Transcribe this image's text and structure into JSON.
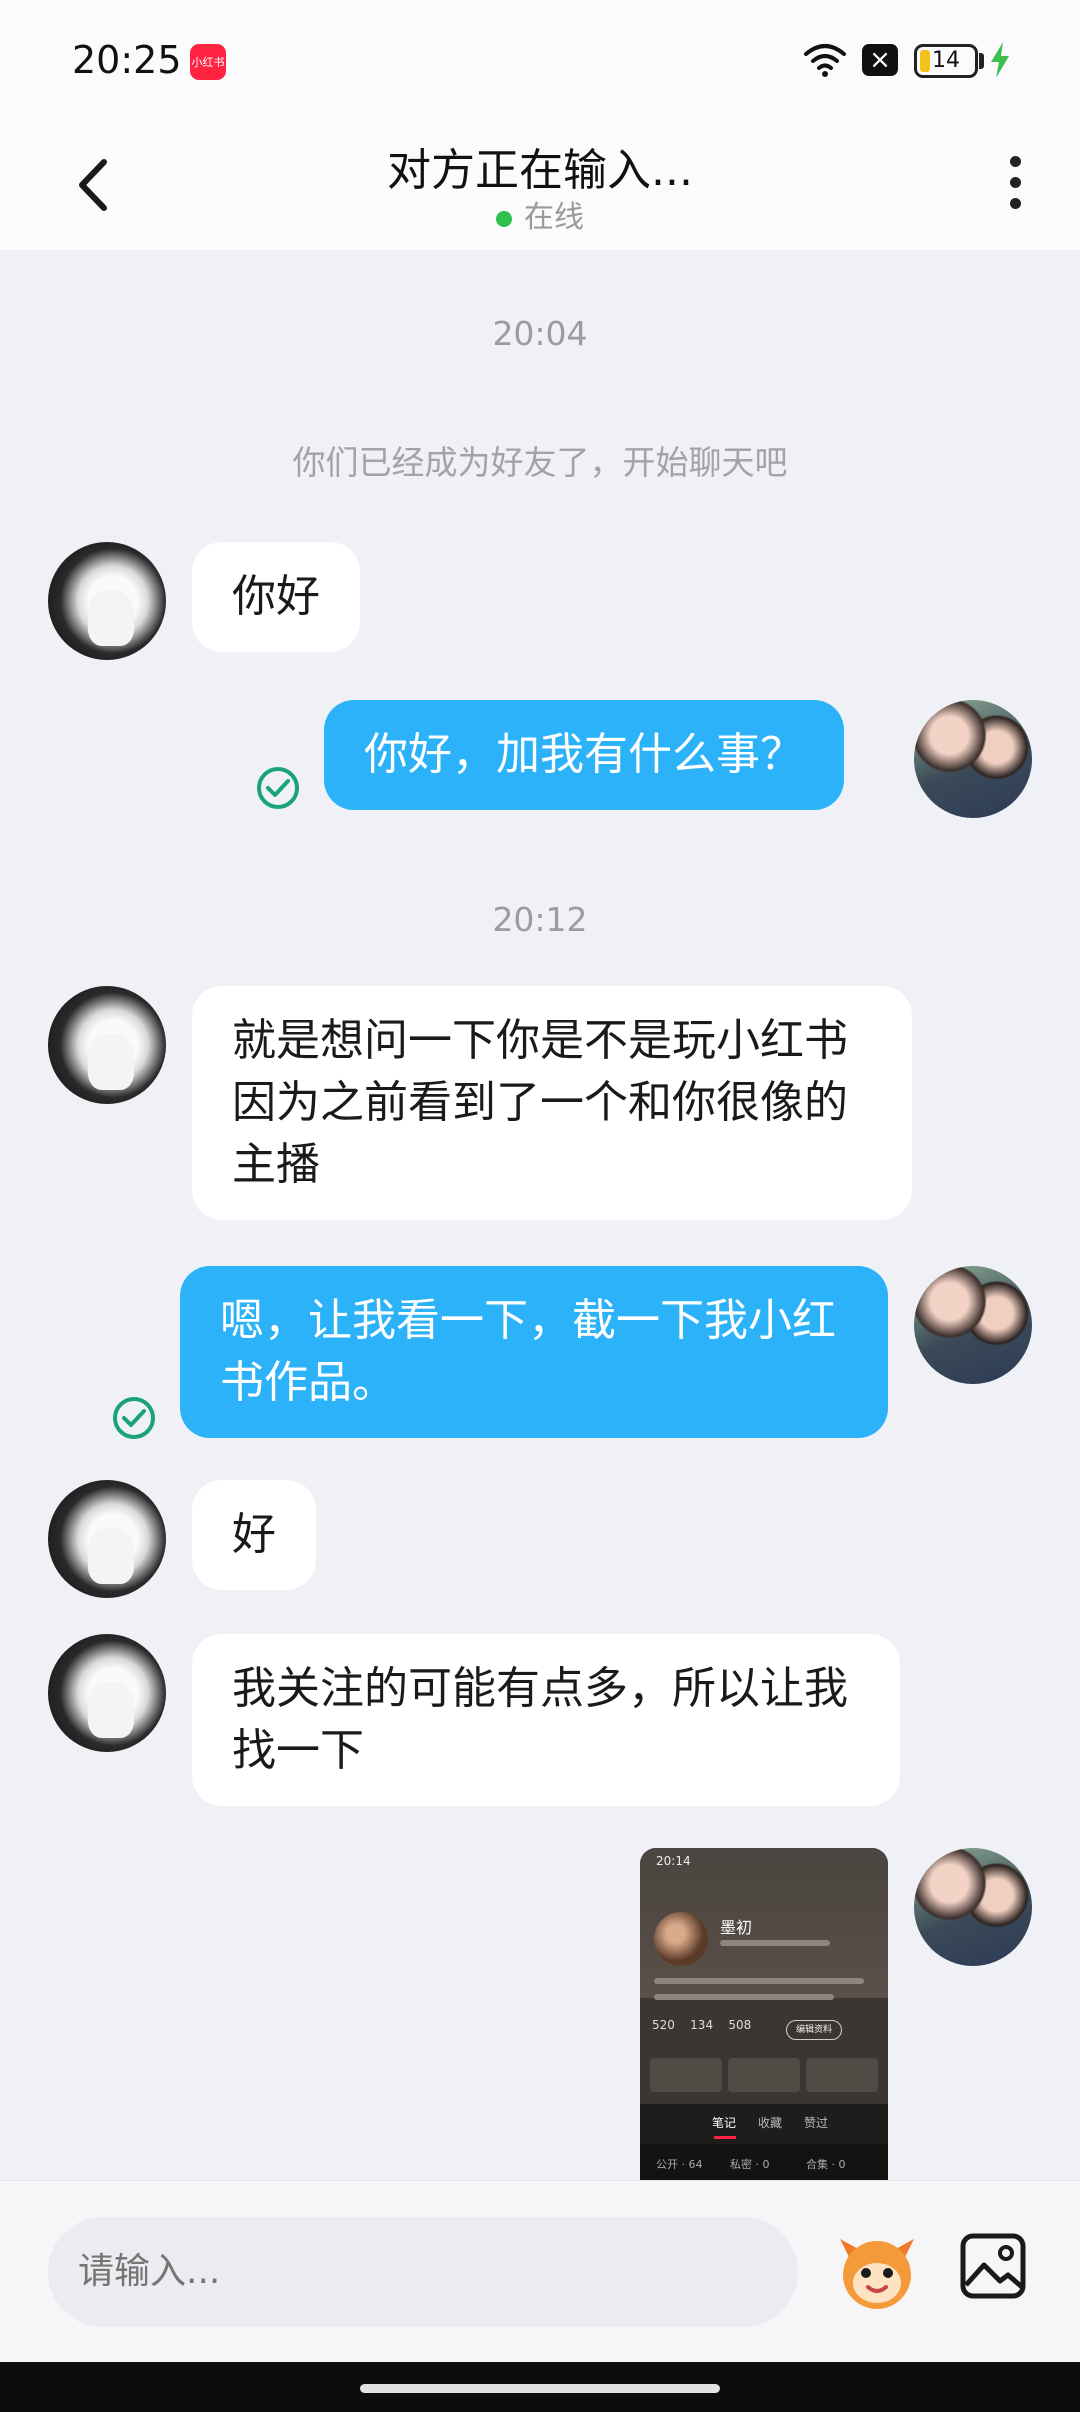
{
  "status_bar": {
    "time": "20:25",
    "app_badge": "小红书",
    "battery_level": "14",
    "icons": [
      "wifi-icon",
      "close-notification-icon",
      "battery-icon",
      "charging-icon"
    ]
  },
  "header": {
    "title": "对方正在输入...",
    "status": "在线",
    "colors": {
      "online": "#2ec04f"
    }
  },
  "chat": {
    "timestamps": [
      "20:04",
      "20:12"
    ],
    "system_message": "你们已经成为好友了，开始聊天吧",
    "messages": [
      {
        "sender": "other",
        "text": "你好"
      },
      {
        "sender": "me",
        "text": "你好，加我有什么事？",
        "read": true
      },
      {
        "sender": "other",
        "text": "就是想问一下你是不是玩小红书 因为之前看到了一个和你很像的主播"
      },
      {
        "sender": "me",
        "text": "嗯，让我看一下，截一下我小红书作品。",
        "read": true
      },
      {
        "sender": "other",
        "text": "好"
      },
      {
        "sender": "other",
        "text": "我关注的可能有点多，所以让我找一下"
      }
    ],
    "screenshot": {
      "time": "20:14",
      "name": "墨初",
      "stats": [
        "520",
        "134",
        "508"
      ],
      "edit_label": "编辑资料",
      "tabs": [
        "笔记",
        "收藏",
        "赞过"
      ],
      "sub": [
        "公开 · 64",
        "私密 · 0",
        "合集 · 0"
      ]
    },
    "colors": {
      "outgoing_bubble": "#2cb2f9",
      "incoming_bubble": "#ffffff",
      "read_check": "#1aa37a"
    }
  },
  "input_bar": {
    "placeholder": "请输入..."
  }
}
